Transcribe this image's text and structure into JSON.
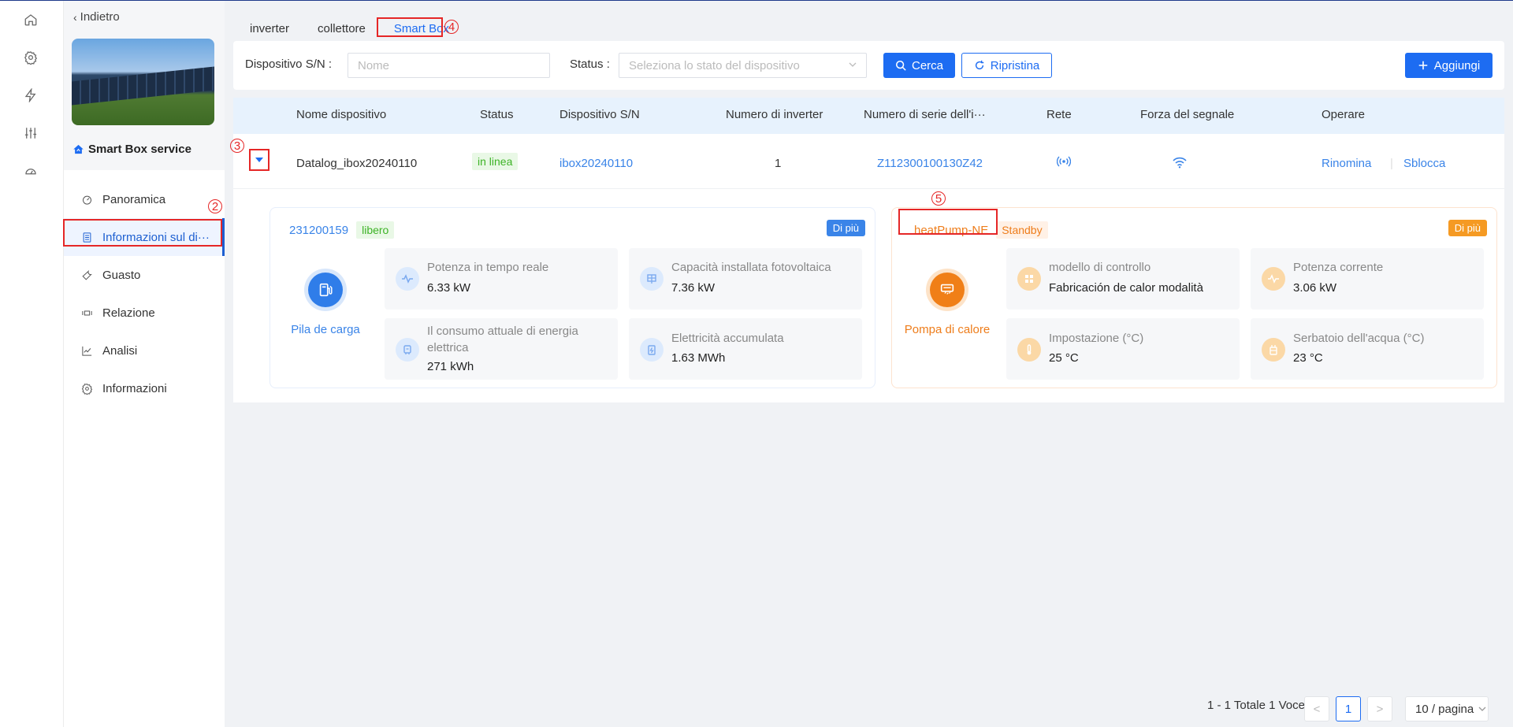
{
  "sidebar": {
    "back_label": "Indietro",
    "site_name": "Smart Box service",
    "items": [
      {
        "label": "Panoramica"
      },
      {
        "label": "Informazioni sul di···"
      },
      {
        "label": "Guasto"
      },
      {
        "label": "Relazione"
      },
      {
        "label": "Analisi"
      },
      {
        "label": "Informazioni"
      }
    ],
    "rail_icons": [
      "home-icon",
      "gear-icon",
      "bolt-icon",
      "sliders-icon",
      "gauge-icon"
    ]
  },
  "markers": {
    "m2": "2",
    "m3": "3",
    "m4": "4",
    "m5": "5"
  },
  "tabs": [
    {
      "label": "inverter"
    },
    {
      "label": "collettore"
    },
    {
      "label": "Smart Box"
    }
  ],
  "filter": {
    "sn_label": "Dispositivo S/N :",
    "sn_placeholder": "Nome",
    "status_label": "Status :",
    "status_placeholder": "Seleziona lo stato del dispositivo",
    "search_label": "Cerca",
    "reset_label": "Ripristina",
    "add_label": "Aggiungi"
  },
  "table": {
    "headers": [
      "Nome dispositivo",
      "Status",
      "Dispositivo S/N",
      "Numero di inverter",
      "Numero di serie dell'i···",
      "Rete",
      "Forza del segnale",
      "Operare"
    ],
    "row": {
      "name": "Datalog_ibox20240110",
      "status": "in linea",
      "sn": "ibox20240110",
      "inverter_count": "1",
      "inverter_sn": "Z112300100130Z42",
      "op_rename": "Rinomina",
      "op_unlock": "Sblocca"
    }
  },
  "card_left": {
    "id": "231200159",
    "tag": "libero",
    "more": "Di più",
    "device": "Pila de carga",
    "metrics": [
      {
        "label": "Potenza in tempo reale",
        "value": "6.33 kW"
      },
      {
        "label": "Capacità installata fotovoltaica",
        "value": "7.36 kW"
      },
      {
        "label": "Il consumo attuale di energia elettrica",
        "value": "271 kWh"
      },
      {
        "label": "Elettricità accumulata",
        "value": "1.63 MWh"
      }
    ]
  },
  "card_right": {
    "id": "heatPump-NE",
    "tag": "Standby",
    "more": "Di più",
    "device": "Pompa di calore",
    "metrics": [
      {
        "label": "modello di controllo",
        "value": "Fabricación de calor modalità"
      },
      {
        "label": "Potenza corrente",
        "value": "3.06 kW"
      },
      {
        "label": "Impostazione (°C)",
        "value": "25 °C"
      },
      {
        "label": "Serbatoio dell'acqua (°C)",
        "value": "23 °C"
      }
    ]
  },
  "pagination": {
    "summary": "1 - 1 Totale 1 Voce",
    "prev": "<",
    "page": "1",
    "next": ">",
    "page_size": "10 / pagina"
  },
  "colors": {
    "primary": "#1d6cf2",
    "online": "#3db326",
    "standby": "#ee7d1b",
    "highlight": "#e52727"
  }
}
